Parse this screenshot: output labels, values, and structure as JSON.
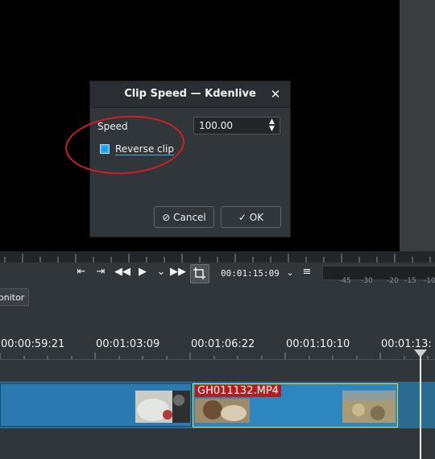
{
  "dialog": {
    "title": "Clip Speed — Kdenlive",
    "close_glyph": "✕",
    "speed_label": "Speed",
    "speed_value": "100.00",
    "reverse_label": "Reverse clip",
    "reverse_checked": true,
    "cancel_label": "Cancel",
    "ok_label": "OK",
    "cancel_icon": "⊘",
    "ok_icon": "✓"
  },
  "toolbar": {
    "timecode": "00:01:15:09",
    "meter_labels": [
      "-45",
      "-30",
      "-20",
      "-15",
      "-10"
    ]
  },
  "panel": {
    "tab_label": "onitor"
  },
  "timeline": {
    "time_labels": [
      "00:00:59:21",
      "00:01:03:09",
      "00:01:06:22",
      "00:01:10:10",
      "00:01:13:"
    ],
    "clip_name": "GH011132.MP4"
  },
  "colors": {
    "accent": "#3daee9",
    "annotation": "#cc1f2a",
    "clip_label_bg": "#b71c1c",
    "selected_clip_border": "#e2d84a"
  }
}
